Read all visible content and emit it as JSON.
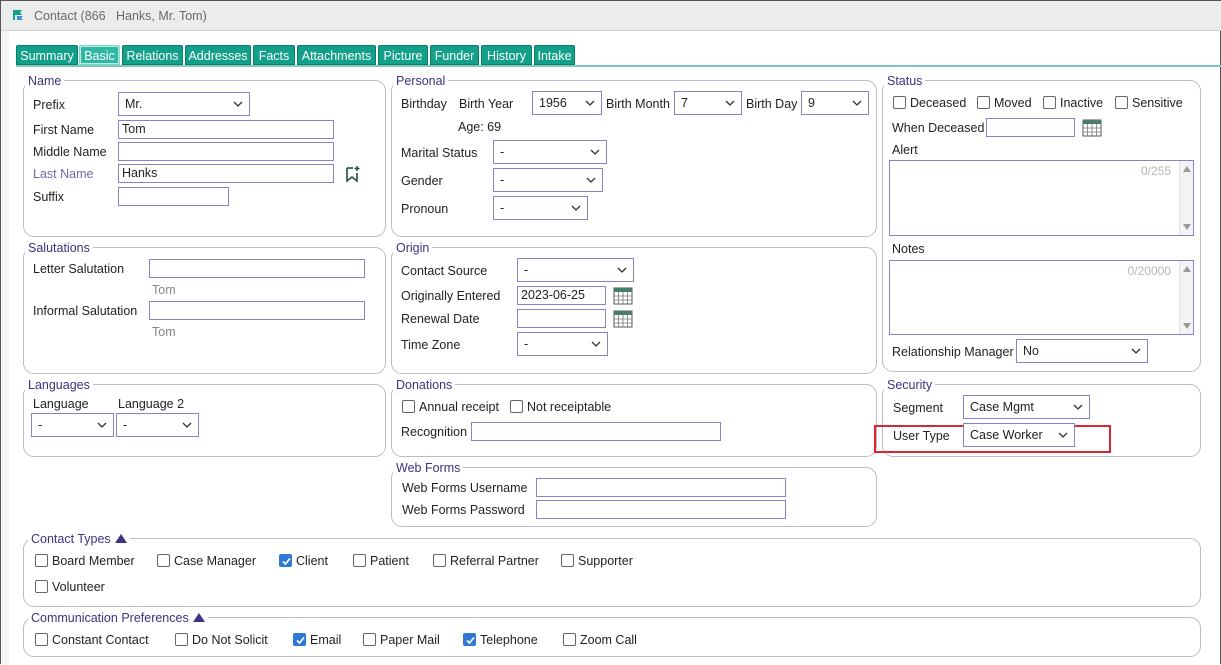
{
  "window": {
    "title": "Contact (866   Hanks, Mr. Tom)"
  },
  "tabs": [
    {
      "label": "Summary"
    },
    {
      "label": "Basic"
    },
    {
      "label": "Relations"
    },
    {
      "label": "Addresses"
    },
    {
      "label": "Facts"
    },
    {
      "label": "Attachments"
    },
    {
      "label": "Picture"
    },
    {
      "label": "Funder"
    },
    {
      "label": "History"
    },
    {
      "label": "Intake"
    }
  ],
  "name": {
    "title": "Name",
    "prefix_label": "Prefix",
    "prefix_value": "Mr.",
    "first_label": "First Name",
    "first_value": "Tom",
    "middle_label": "Middle Name",
    "middle_value": "",
    "last_label": "Last Name",
    "last_value": "Hanks",
    "suffix_label": "Suffix",
    "suffix_value": ""
  },
  "personal": {
    "title": "Personal",
    "birthday_label": "Birthday",
    "birth_year_label": "Birth Year",
    "birth_year_value": "1956",
    "birth_month_label": "Birth Month",
    "birth_month_value": "7",
    "birth_day_label": "Birth Day",
    "birth_day_value": "9",
    "age_text": "Age: 69",
    "marital_label": "Marital Status",
    "marital_value": "-",
    "gender_label": "Gender",
    "gender_value": "-",
    "pronoun_label": "Pronoun",
    "pronoun_value": "-"
  },
  "status": {
    "title": "Status",
    "deceased": "Deceased",
    "moved": "Moved",
    "inactive": "Inactive",
    "sensitive": "Sensitive",
    "when_deceased_label": "When Deceased",
    "when_deceased_value": "",
    "alert_label": "Alert",
    "alert_count": "0/255",
    "notes_label": "Notes",
    "notes_count": "0/20000",
    "relationship_manager_label": "Relationship Manager",
    "relationship_manager_value": "No"
  },
  "salutations": {
    "title": "Salutations",
    "letter_label": "Letter Salutation",
    "letter_value": "",
    "letter_hint": "Tom",
    "informal_label": "Informal Salutation",
    "informal_value": "",
    "informal_hint": "Tom"
  },
  "origin": {
    "title": "Origin",
    "source_label": "Contact Source",
    "source_value": "-",
    "entered_label": "Originally Entered",
    "entered_value": "2023-06-25",
    "renewal_label": "Renewal Date",
    "renewal_value": "",
    "timezone_label": "Time Zone",
    "timezone_value": "-"
  },
  "languages": {
    "title": "Languages",
    "lang1_label": "Language",
    "lang1_value": "-",
    "lang2_label": "Language 2",
    "lang2_value": "-"
  },
  "donations": {
    "title": "Donations",
    "annual_receipt": "Annual receipt",
    "not_receiptable": "Not receiptable",
    "recognition_label": "Recognition",
    "recognition_value": ""
  },
  "security": {
    "title": "Security",
    "segment_label": "Segment",
    "segment_value": "Case Mgmt",
    "user_type_label": "User Type",
    "user_type_value": "Case Worker"
  },
  "webforms": {
    "title": "Web Forms",
    "username_label": "Web Forms Username",
    "username_value": "",
    "password_label": "Web Forms Password",
    "password_value": ""
  },
  "contact_types": {
    "title": "Contact Types",
    "items": [
      {
        "label": "Board Member",
        "checked": false
      },
      {
        "label": "Case Manager",
        "checked": false
      },
      {
        "label": "Client",
        "checked": true
      },
      {
        "label": "Patient",
        "checked": false
      },
      {
        "label": "Referral Partner",
        "checked": false
      },
      {
        "label": "Supporter",
        "checked": false
      },
      {
        "label": "Volunteer",
        "checked": false
      }
    ]
  },
  "comm_prefs": {
    "title": "Communication Preferences",
    "items": [
      {
        "label": "Constant Contact",
        "checked": false
      },
      {
        "label": "Do Not Solicit",
        "checked": false
      },
      {
        "label": "Email",
        "checked": true
      },
      {
        "label": "Paper Mail",
        "checked": false
      },
      {
        "label": "Telephone",
        "checked": true
      },
      {
        "label": "Zoom Call",
        "checked": false
      }
    ]
  },
  "colors": {
    "tab": "#12a08a",
    "accent": "#3b3380",
    "checkbox_on": "#2f7ad4",
    "highlight": "#d9262f"
  }
}
